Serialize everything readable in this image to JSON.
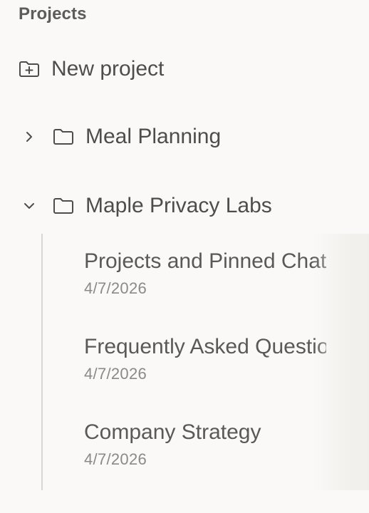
{
  "sidebar": {
    "section_title": "Projects",
    "new_project_label": "New project",
    "projects": [
      {
        "name": "Meal Planning",
        "expanded": false,
        "chevron_icon": "chevron-right-icon"
      },
      {
        "name": "Maple Privacy Labs",
        "expanded": true,
        "chevron_icon": "chevron-down-icon",
        "chats": [
          {
            "title": "Projects and Pinned Chats",
            "date": "4/7/2026"
          },
          {
            "title": "Frequently Asked Questions",
            "date": "4/7/2026"
          },
          {
            "title": "Company Strategy",
            "date": "4/7/2026"
          }
        ]
      }
    ]
  },
  "colors": {
    "background": "#faf9f7",
    "text": "#4d4d4d",
    "muted": "#8a8a8a",
    "tree_line": "#d9d7d3"
  },
  "icons": {
    "new_project": "folder-plus-icon",
    "project": "folder-icon"
  }
}
